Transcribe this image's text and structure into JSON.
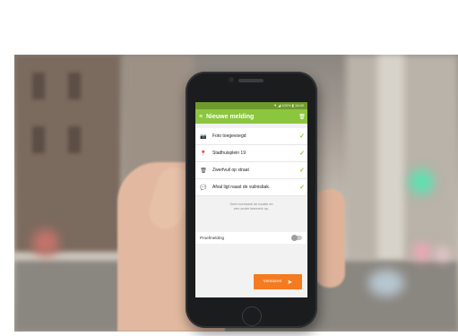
{
  "app": {
    "status_text": "▼ ◢ 100% ▮ 16:00",
    "title": "Nieuwe melding",
    "icons": {
      "menu": "hamburger-menu-icon",
      "trash": "trash-icon"
    }
  },
  "items": [
    {
      "label": "Foto toegevoegd",
      "icon": "camera-icon"
    },
    {
      "label": "Stadhuisplein  19",
      "icon": "map-pin-icon"
    },
    {
      "label": "Zwerfvuil op straat",
      "icon": "trash-bin-icon"
    },
    {
      "label": "Afval ligt naast de vuilnisbak.",
      "icon": "chat-bubble-icon"
    }
  ],
  "hint": {
    "line1": "Geef eventueel de locatie en",
    "line2": "een ander kenmerk op."
  },
  "toggle": {
    "label": "Proefmelding",
    "on": false
  },
  "send": {
    "label": "Versturen",
    "icon": "send-arrow-icon"
  },
  "colors": {
    "accent": "#8cc63f",
    "send": "#f47b20"
  }
}
